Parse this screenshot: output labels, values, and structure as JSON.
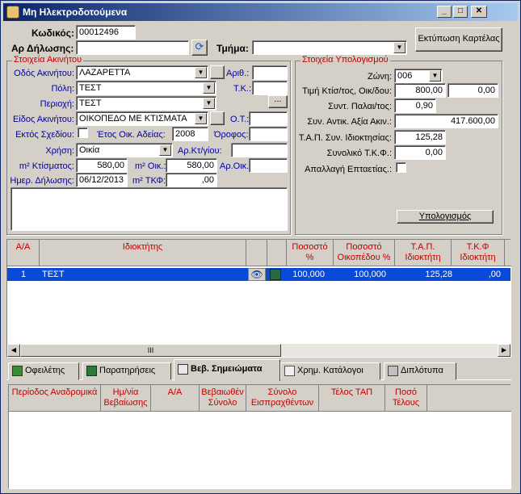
{
  "window": {
    "title": "Μη Ηλεκτροδοτούμενα",
    "minimize": "_",
    "maximize": "□",
    "close": "✕"
  },
  "top": {
    "code_label": "Κωδικός:",
    "code_value": "00012496",
    "decl_label": "Αρ Δήλωσης:",
    "decl_value": "",
    "dept_label": "Τμήμα:",
    "dept_value": "",
    "print_button": "Εκτύπωση Καρτέλας"
  },
  "property": {
    "group_title": "Στοιχεία Ακινήτου",
    "street_label": "Οδός Ακινήτου:",
    "street_value": "ΛΑΖΑΡΕΤΤΑ",
    "num_label": "Αριθ.:",
    "num_value": "",
    "city_label": "Πόλη:",
    "city_value": "ΤΕΣΤ",
    "zip_label": "Τ.Κ.:",
    "zip_value": "",
    "area_label": "Περιοχή:",
    "area_value": "ΤΕΣΤ",
    "type_label": "Είδος Ακινήτου:",
    "type_value": "ΟΙΚΟΠΕΔΟ ΜΕ ΚΤΙΣΜΑΤΑ",
    "ot_label": "Ο.Τ.:",
    "ot_value": "",
    "outside_label": "Εκτός Σχεδίου:",
    "year_label": "Έτος Οικ. Αδείας:",
    "year_value": "2008",
    "floor_label": "Όροφος:",
    "floor_value": "",
    "use_label": "Χρήση:",
    "use_value": "Οικία",
    "kt_label": "Αρ.Κτ/γίου:",
    "kt_value": "",
    "m2_build_label": "m² Κτίσματος:",
    "m2_build_value": "580,00",
    "m2_oik_label": "m² Οικ.:",
    "m2_oik_value": "580,00",
    "ar_oik_label": "Αρ.Οικ.:",
    "ar_oik_value": "",
    "date_label": "Ημερ. Δήλωσης:",
    "date_value": "06/12/2013",
    "tkf_label": "m² ΤΚΦ:",
    "tkf_value": ",00",
    "ellipsis": "..."
  },
  "calc": {
    "group_title": "Στοιχεία Υπολογισμού",
    "zone_label": "Ζώνη:",
    "zone_value": "006",
    "price_label": "Τιμή Κτίσ/τος, Οικ/δου:",
    "price_value": "800,00",
    "price_value2": "0,00",
    "age_label": "Συντ. Παλαι/τος:",
    "age_value": "0,90",
    "equiv_label": "Συν. Αντικ. Αξία Ακιν.:",
    "equiv_value": "417.600,00",
    "tap_label": "Τ.Α.Π. Συν. Ιδιοκτησίας:",
    "tap_value": "125,28",
    "total_label": "Συνολικό Τ.Κ.Φ.:",
    "total_value": "0,00",
    "exempt_label": "Απαλλαγή Επταετίας.:",
    "calc_button": "Υπολογισμός"
  },
  "owners": {
    "headers": [
      "Α/Α",
      "Ιδιοκτήτης",
      "",
      "",
      "Ποσοστό %",
      "Ποσοστό Οικοπέδου %",
      "Τ.Α.Π. Ιδιοκτήτη",
      "Τ.Κ.Φ Ιδιοκτήτη"
    ],
    "rows": [
      {
        "aa": "1",
        "owner": "ΤΕΣΤ",
        "pct": "100,000",
        "pct_plot": "100,000",
        "tap": "125,28",
        "tkf": ",00"
      }
    ],
    "scroll_thumb": "III"
  },
  "tabs": [
    {
      "label": "Οφειλέτης"
    },
    {
      "label": "Παρατηρήσεις"
    },
    {
      "label": "Βεβ. Σημειώματα"
    },
    {
      "label": "Χρημ. Κατάλογοι"
    },
    {
      "label": "Διπλότυπα"
    }
  ],
  "notes": {
    "headers": [
      "Περίοδος Αναδρομικά",
      "Ημ/νία Βεβαίωσης",
      "Α/Α",
      "Βεβαιωθέν Σύνολο",
      "Σύνολο Εισπραχθέντων",
      "Τέλος ΤΑΠ",
      "Ποσό Τέλους"
    ]
  }
}
